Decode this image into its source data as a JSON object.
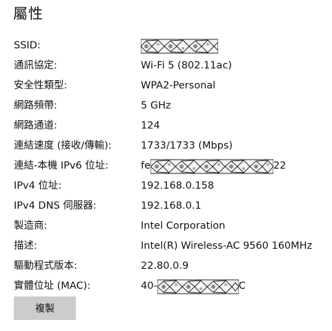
{
  "title": "屬性",
  "properties": [
    {
      "label": "SSID:",
      "value": ""
    },
    {
      "label": "通訊協定:",
      "value": "Wi-Fi 5 (802.11ac)"
    },
    {
      "label": "安全性類型:",
      "value": "WPA2-Personal"
    },
    {
      "label": "網路頻帶:",
      "value": "5 GHz"
    },
    {
      "label": "網路通道:",
      "value": "124"
    },
    {
      "label": "連結速度 (接收/傳輸):",
      "value": "1733/1733 (Mbps)"
    },
    {
      "label": "連結-本機 IPv6 位址:",
      "prefix": "fe",
      "suffix": "22"
    },
    {
      "label": "IPv4 位址:",
      "value": "192.168.0.158"
    },
    {
      "label": "IPv4 DNS 伺服器:",
      "value": "192.168.0.1"
    },
    {
      "label": "製造商:",
      "value": "Intel Corporation"
    },
    {
      "label": "描述:",
      "value": "Intel(R) Wireless-AC 9560 160MHz"
    },
    {
      "label": "驅動程式版本:",
      "value": "22.80.0.9"
    },
    {
      "label": "實體位址 (MAC):",
      "prefix": "40-",
      "suffix": "C"
    }
  ],
  "copy_button": {
    "label": "複製"
  }
}
